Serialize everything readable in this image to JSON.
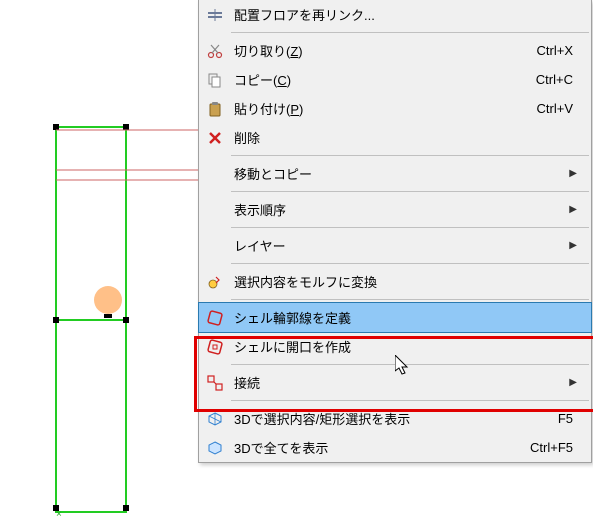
{
  "menu": {
    "relink_floor": "配置フロアを再リンク...",
    "cut": "切り取り(",
    "cut_u": "Z",
    "cut_end": ")",
    "cut_shortcut": "Ctrl+X",
    "copy": "コピー(",
    "copy_u": "C",
    "copy_end": ")",
    "copy_shortcut": "Ctrl+C",
    "paste": "貼り付け(",
    "paste_u": "P",
    "paste_end": ")",
    "paste_shortcut": "Ctrl+V",
    "delete": "削除",
    "move_copy": "移動とコピー",
    "display_order": "表示順序",
    "layer": "レイヤー",
    "convert_morph": "選択内容をモルフに変換",
    "define_shell_contour": "シェル輪郭線を定義",
    "create_shell_opening": "シェルに開口を作成",
    "connect": "接続",
    "show_3d_selection": "3Dで選択内容/矩形選択を表示",
    "show_3d_selection_shortcut": "F5",
    "show_all_3d": "3Dで全てを表示",
    "show_all_3d_shortcut": "Ctrl+F5"
  },
  "icons": {
    "relink": "relink-floor-icon",
    "cut": "cut-icon",
    "copy": "copy-icon",
    "paste": "paste-icon",
    "delete": "delete-icon",
    "morph": "morph-icon",
    "shell_contour": "shell-contour-icon",
    "shell_opening": "shell-opening-icon",
    "connect": "connect-icon",
    "show3d": "show-3d-icon"
  }
}
